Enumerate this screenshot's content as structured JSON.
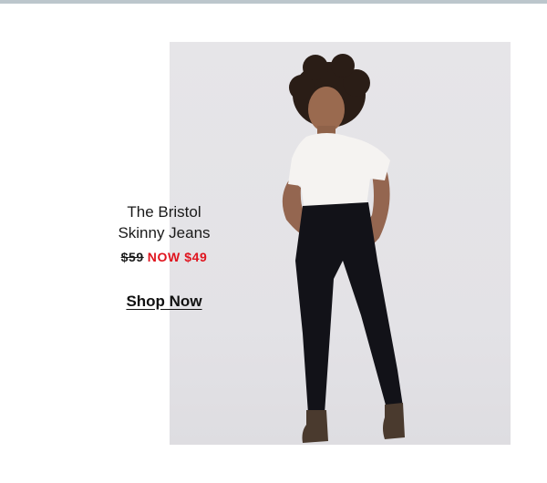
{
  "product": {
    "title_line1": "The Bristol",
    "title_line2": "Skinny Jeans",
    "old_price": "$59",
    "new_price": "NOW $49"
  },
  "cta": {
    "label": "Shop Now"
  },
  "colors": {
    "sale": "#e0141e",
    "text": "#1a1a1a",
    "photo_background": "#e4e3e7",
    "top_rule": "#bcc6cc"
  }
}
